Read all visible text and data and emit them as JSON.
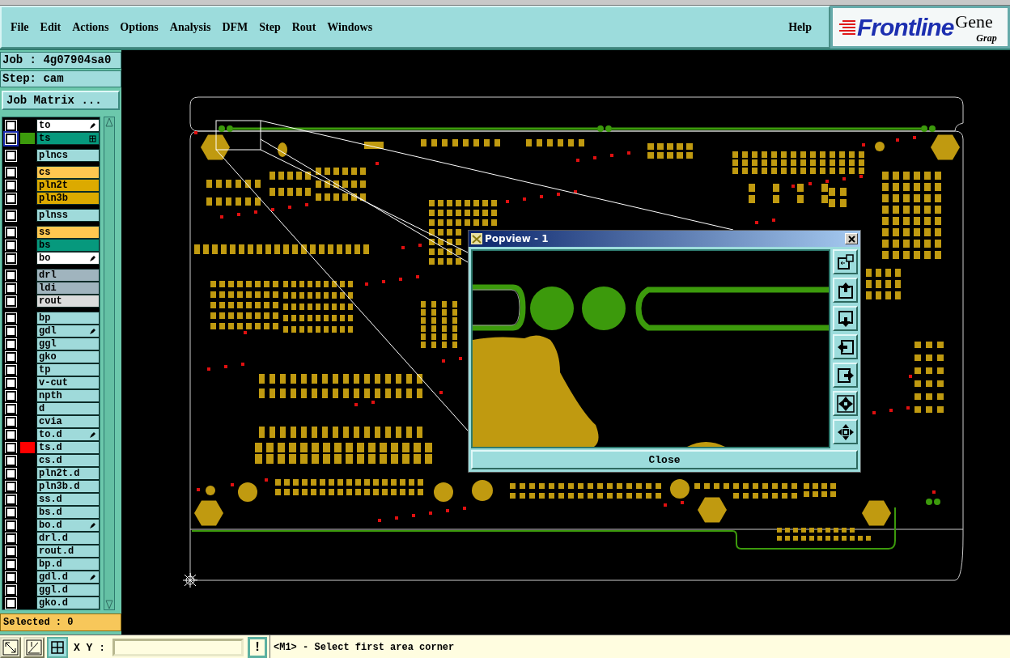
{
  "menu": [
    {
      "label": "File"
    },
    {
      "label": "Edit"
    },
    {
      "label": "Actions"
    },
    {
      "label": "Options"
    },
    {
      "label": "Analysis"
    },
    {
      "label": "DFM"
    },
    {
      "label": "Step"
    },
    {
      "label": "Rout"
    },
    {
      "label": "Windows"
    }
  ],
  "help": "Help",
  "logo": {
    "brand": "Frontline",
    "product": "Gene",
    "subtitle": "Grap"
  },
  "job": "Job : 4g07904sa0",
  "step": "Step: cam",
  "job_matrix_button": "Job Matrix ...",
  "layer_groups": [
    {
      "layers": [
        {
          "name": "to",
          "color": "#ffffff",
          "checked": false,
          "focused": false,
          "edited": true,
          "linked": false
        },
        {
          "name": "ts",
          "color": "#06997d",
          "swatch": {
            "color": "#3c9a0c"
          },
          "checked": false,
          "focused": true,
          "edited": false,
          "linked": true
        }
      ]
    },
    {
      "layers": [
        {
          "name": "plncs",
          "color": "#9fdada",
          "checked": false,
          "focused": false,
          "edited": false,
          "linked": false
        }
      ]
    },
    {
      "layers": [
        {
          "name": "cs",
          "color": "#ffc850",
          "checked": false,
          "focused": false,
          "edited": false,
          "linked": false
        },
        {
          "name": "pln2t",
          "color": "#dcaa00",
          "checked": false,
          "focused": false,
          "edited": false,
          "linked": false
        },
        {
          "name": "pln3b",
          "color": "#dcaa00",
          "checked": false,
          "focused": false,
          "edited": false,
          "linked": false
        }
      ]
    },
    {
      "layers": [
        {
          "name": "plnss",
          "color": "#9fdada",
          "checked": false,
          "focused": false,
          "edited": false,
          "linked": false
        }
      ]
    },
    {
      "layers": [
        {
          "name": "ss",
          "color": "#ffc850",
          "checked": false,
          "focused": false,
          "edited": false,
          "linked": false
        },
        {
          "name": "bs",
          "color": "#06997d",
          "checked": false,
          "focused": false,
          "edited": false,
          "linked": false
        },
        {
          "name": "bo",
          "color": "#ffffff",
          "checked": false,
          "focused": false,
          "edited": true,
          "linked": false
        }
      ]
    },
    {
      "layers": [
        {
          "name": "drl",
          "color": "#a0b4be",
          "checked": false,
          "focused": false,
          "edited": false,
          "linked": false
        },
        {
          "name": "ldi",
          "color": "#a0b4be",
          "checked": false,
          "focused": false,
          "edited": false,
          "linked": false
        },
        {
          "name": "rout",
          "color": "#dcdcdc",
          "checked": false,
          "focused": false,
          "edited": false,
          "linked": false
        }
      ]
    },
    {
      "layers": [
        {
          "name": "bp",
          "color": "#9fdada",
          "checked": false,
          "focused": false,
          "edited": false,
          "linked": false
        },
        {
          "name": "gdl",
          "color": "#9fdada",
          "checked": false,
          "focused": false,
          "edited": true,
          "linked": false
        },
        {
          "name": "ggl",
          "color": "#9fdada",
          "checked": false,
          "focused": false,
          "edited": false,
          "linked": false
        },
        {
          "name": "gko",
          "color": "#9fdada",
          "checked": false,
          "focused": false,
          "edited": false,
          "linked": false
        },
        {
          "name": "tp",
          "color": "#9fdada",
          "checked": false,
          "focused": false,
          "edited": false,
          "linked": false
        },
        {
          "name": "v-cut",
          "color": "#9fdada",
          "checked": false,
          "focused": false,
          "edited": false,
          "linked": false
        },
        {
          "name": "npth",
          "color": "#9fdada",
          "checked": false,
          "focused": false,
          "edited": false,
          "linked": false
        },
        {
          "name": "d",
          "color": "#9fdada",
          "checked": false,
          "focused": false,
          "edited": false,
          "linked": false
        },
        {
          "name": "cvia",
          "color": "#9fdada",
          "checked": false,
          "focused": false,
          "edited": false,
          "linked": false
        },
        {
          "name": "to.d",
          "color": "#9fdada",
          "checked": false,
          "focused": false,
          "edited": true,
          "linked": false
        },
        {
          "name": "ts.d",
          "color": "#9fdada",
          "swatch": {
            "color": "#ff0000"
          },
          "checked": false,
          "focused": false,
          "edited": false,
          "linked": false
        },
        {
          "name": "cs.d",
          "color": "#9fdada",
          "checked": false,
          "focused": false,
          "edited": false,
          "linked": false
        },
        {
          "name": "pln2t.d",
          "color": "#9fdada",
          "checked": false,
          "focused": false,
          "edited": false,
          "linked": false
        },
        {
          "name": "pln3b.d",
          "color": "#9fdada",
          "checked": false,
          "focused": false,
          "edited": false,
          "linked": false
        },
        {
          "name": "ss.d",
          "color": "#9fdada",
          "checked": false,
          "focused": false,
          "edited": false,
          "linked": false
        },
        {
          "name": "bs.d",
          "color": "#9fdada",
          "checked": false,
          "focused": false,
          "edited": false,
          "linked": false
        },
        {
          "name": "bo.d",
          "color": "#9fdada",
          "checked": false,
          "focused": false,
          "edited": true,
          "linked": false
        },
        {
          "name": "drl.d",
          "color": "#9fdada",
          "checked": false,
          "focused": false,
          "edited": false,
          "linked": false
        },
        {
          "name": "rout.d",
          "color": "#9fdada",
          "checked": false,
          "focused": false,
          "edited": false,
          "linked": false
        },
        {
          "name": "bp.d",
          "color": "#9fdada",
          "checked": false,
          "focused": false,
          "edited": false,
          "linked": false
        },
        {
          "name": "gdl.d",
          "color": "#9fdada",
          "checked": false,
          "focused": false,
          "edited": true,
          "linked": false
        },
        {
          "name": "ggl.d",
          "color": "#9fdada",
          "checked": false,
          "focused": false,
          "edited": false,
          "linked": false
        },
        {
          "name": "gko.d",
          "color": "#9fdada",
          "checked": false,
          "focused": false,
          "edited": false,
          "linked": false
        }
      ]
    }
  ],
  "selected_count": "Selected : 0",
  "popview": {
    "title": "Popview - 1",
    "close_button": "Close"
  },
  "status_bar": {
    "xy_label": "X Y :",
    "alert_button": "!",
    "message": "<M1> - Select first area corner"
  }
}
